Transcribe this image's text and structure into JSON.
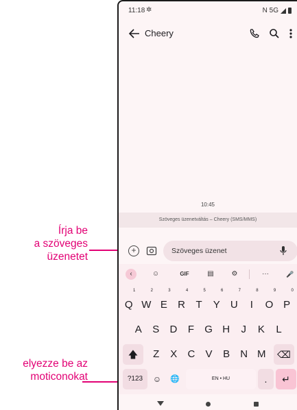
{
  "callouts": {
    "type_text": [
      "Írja be",
      "a szöveges",
      "üzenetet"
    ],
    "emoji": [
      "elyezze be az",
      "moticonokat"
    ]
  },
  "colors": {
    "accent": "#e20074",
    "surface": "#fdf5f6",
    "key_pink": "#f9c4d4"
  },
  "status_bar": {
    "time": "11:18",
    "network": "N 5G",
    "settings_icon": "gear-icon"
  },
  "app_bar": {
    "back_icon": "arrow-back-icon",
    "title": "Cheery",
    "call_icon": "phone-icon",
    "search_icon": "search-icon",
    "more_icon": "more-vert-icon"
  },
  "conversation": {
    "timestamp": "10:45",
    "type_label": "Szöveges üzenetváltás – Cheery (SMS/MMS)"
  },
  "compose": {
    "placeholder": "Szöveges üzenet",
    "add_icon": "add-circle-icon",
    "gallery_icon": "gallery-icon",
    "mic_icon": "mic-icon"
  },
  "keyboard": {
    "toolbar": [
      "‹",
      "☺",
      "GIF",
      "▤",
      "⚙",
      "···",
      "🎤"
    ],
    "rows": [
      [
        {
          "k": "Q",
          "h": "1"
        },
        {
          "k": "W",
          "h": "2"
        },
        {
          "k": "E",
          "h": "3"
        },
        {
          "k": "R",
          "h": "4"
        },
        {
          "k": "T",
          "h": "5"
        },
        {
          "k": "Y",
          "h": "6"
        },
        {
          "k": "U",
          "h": "7"
        },
        {
          "k": "I",
          "h": "8"
        },
        {
          "k": "O",
          "h": "9"
        },
        {
          "k": "P",
          "h": "0"
        }
      ],
      [
        {
          "k": "A"
        },
        {
          "k": "S"
        },
        {
          "k": "D"
        },
        {
          "k": "F"
        },
        {
          "k": "G"
        },
        {
          "k": "H"
        },
        {
          "k": "J"
        },
        {
          "k": "K"
        },
        {
          "k": "L"
        }
      ],
      [
        {
          "k": "Z"
        },
        {
          "k": "X"
        },
        {
          "k": "C"
        },
        {
          "k": "V"
        },
        {
          "k": "B"
        },
        {
          "k": "N"
        },
        {
          "k": "M"
        }
      ]
    ],
    "shift": "🡅",
    "backspace": "⌫",
    "symbols": "?123",
    "emoji_key": "☺",
    "globe": "🌐",
    "space": "EN • HU",
    "period": ".",
    "enter": "↵"
  },
  "nav": {
    "back": "nav-back-icon",
    "home": "nav-home-icon",
    "recents": "nav-recents-icon"
  }
}
